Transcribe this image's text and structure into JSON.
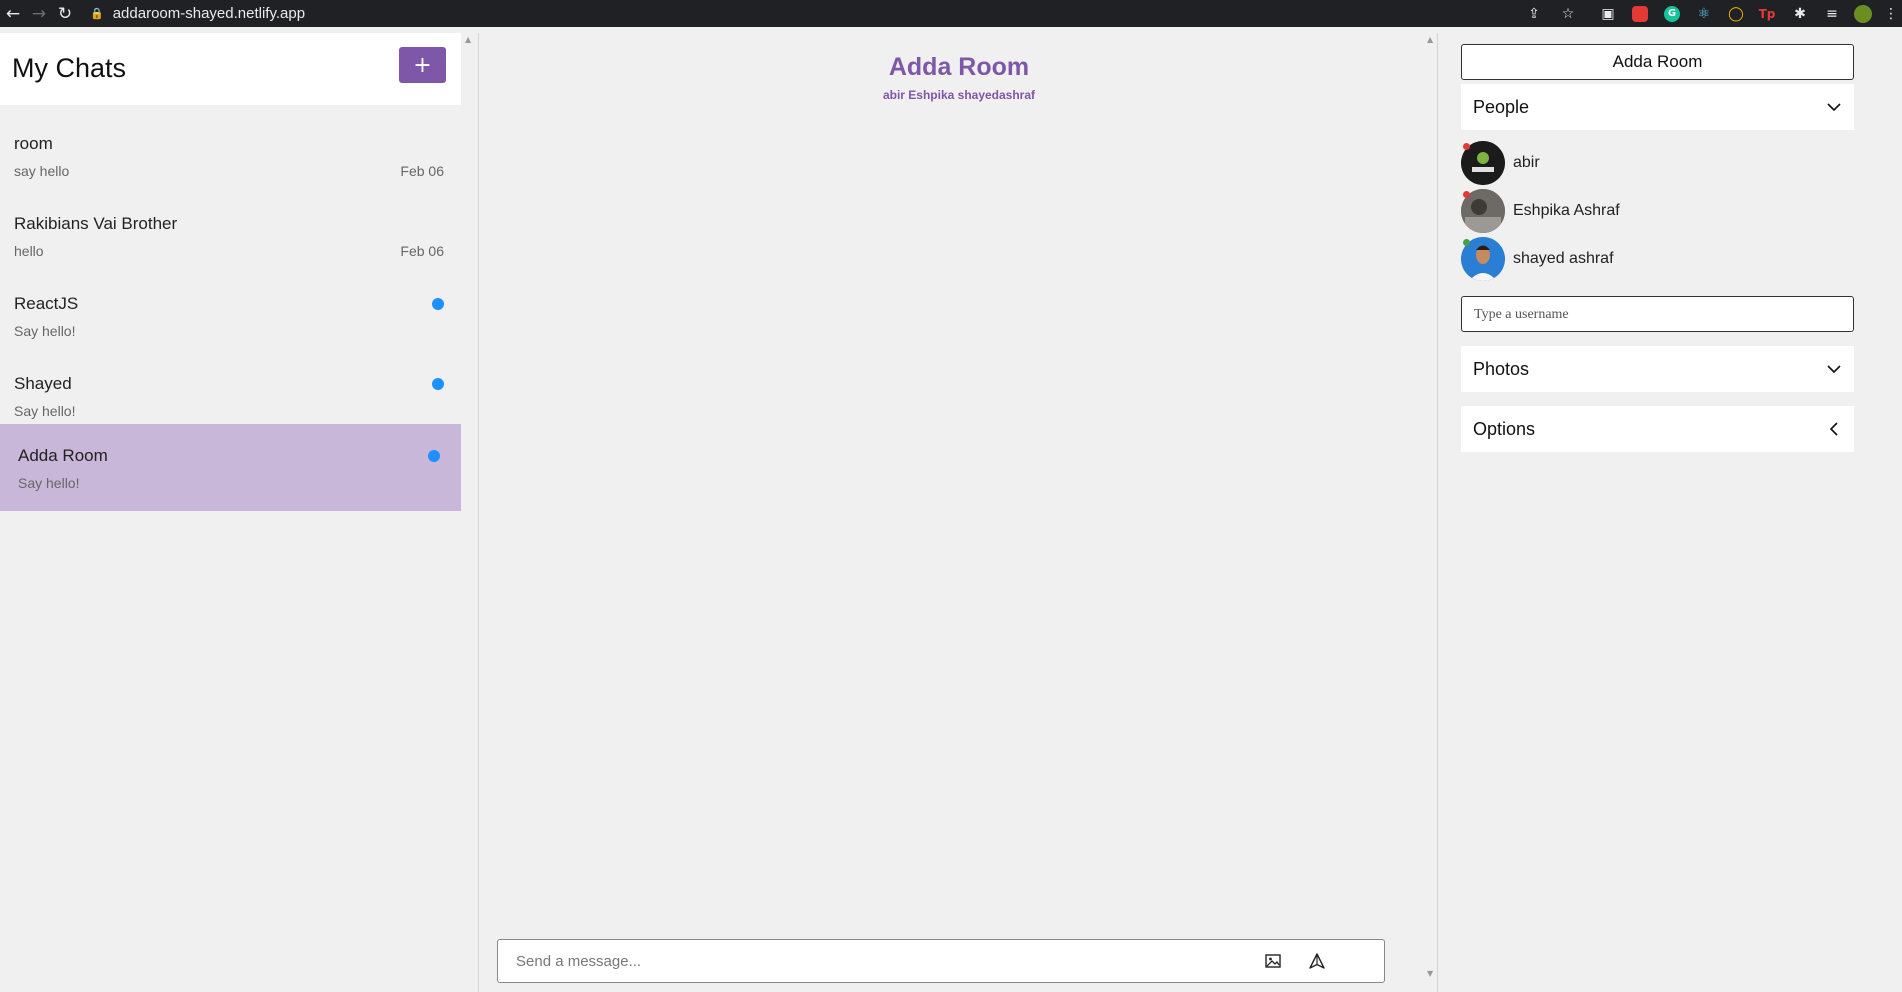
{
  "browser": {
    "url": "addaroom-shayed.netlify.app",
    "back_icon": "arrow-left",
    "forward_icon": "arrow-right",
    "reload_icon": "reload",
    "lock_icon": "lock"
  },
  "sidebar": {
    "title": "My Chats",
    "new_chat_label": "+",
    "chats": [
      {
        "name": "room",
        "preview": "say hello",
        "date": "Feb 06",
        "unread": false,
        "active": false
      },
      {
        "name": "Rakibians Vai Brother",
        "preview": "hello",
        "date": "Feb 06",
        "unread": false,
        "active": false
      },
      {
        "name": "ReactJS",
        "preview": "Say hello!",
        "date": "",
        "unread": true,
        "active": false
      },
      {
        "name": "Shayed",
        "preview": "Say hello!",
        "date": "",
        "unread": true,
        "active": false
      },
      {
        "name": "Adda Room",
        "preview": "Say hello!",
        "date": "",
        "unread": true,
        "active": true
      }
    ]
  },
  "chat": {
    "title": "Adda Room",
    "members": "abir Eshpika shayedashraf",
    "composer_placeholder": "Send a message..."
  },
  "details": {
    "room_name": "Adda Room",
    "people_title": "People",
    "people": [
      {
        "name": "abir",
        "avatar_color": "#1b1b1b"
      },
      {
        "name": "Eshpika Ashraf",
        "avatar_color": "#6d6a66"
      },
      {
        "name": "shayed ashraf",
        "avatar_color": "#2a7fd4"
      }
    ],
    "username_placeholder": "Type a username",
    "photos_title": "Photos",
    "options_title": "Options"
  },
  "colors": {
    "accent": "#7e57a8",
    "active_chat_bg": "#c8b7d9",
    "unread_dot": "#1e90ff"
  }
}
